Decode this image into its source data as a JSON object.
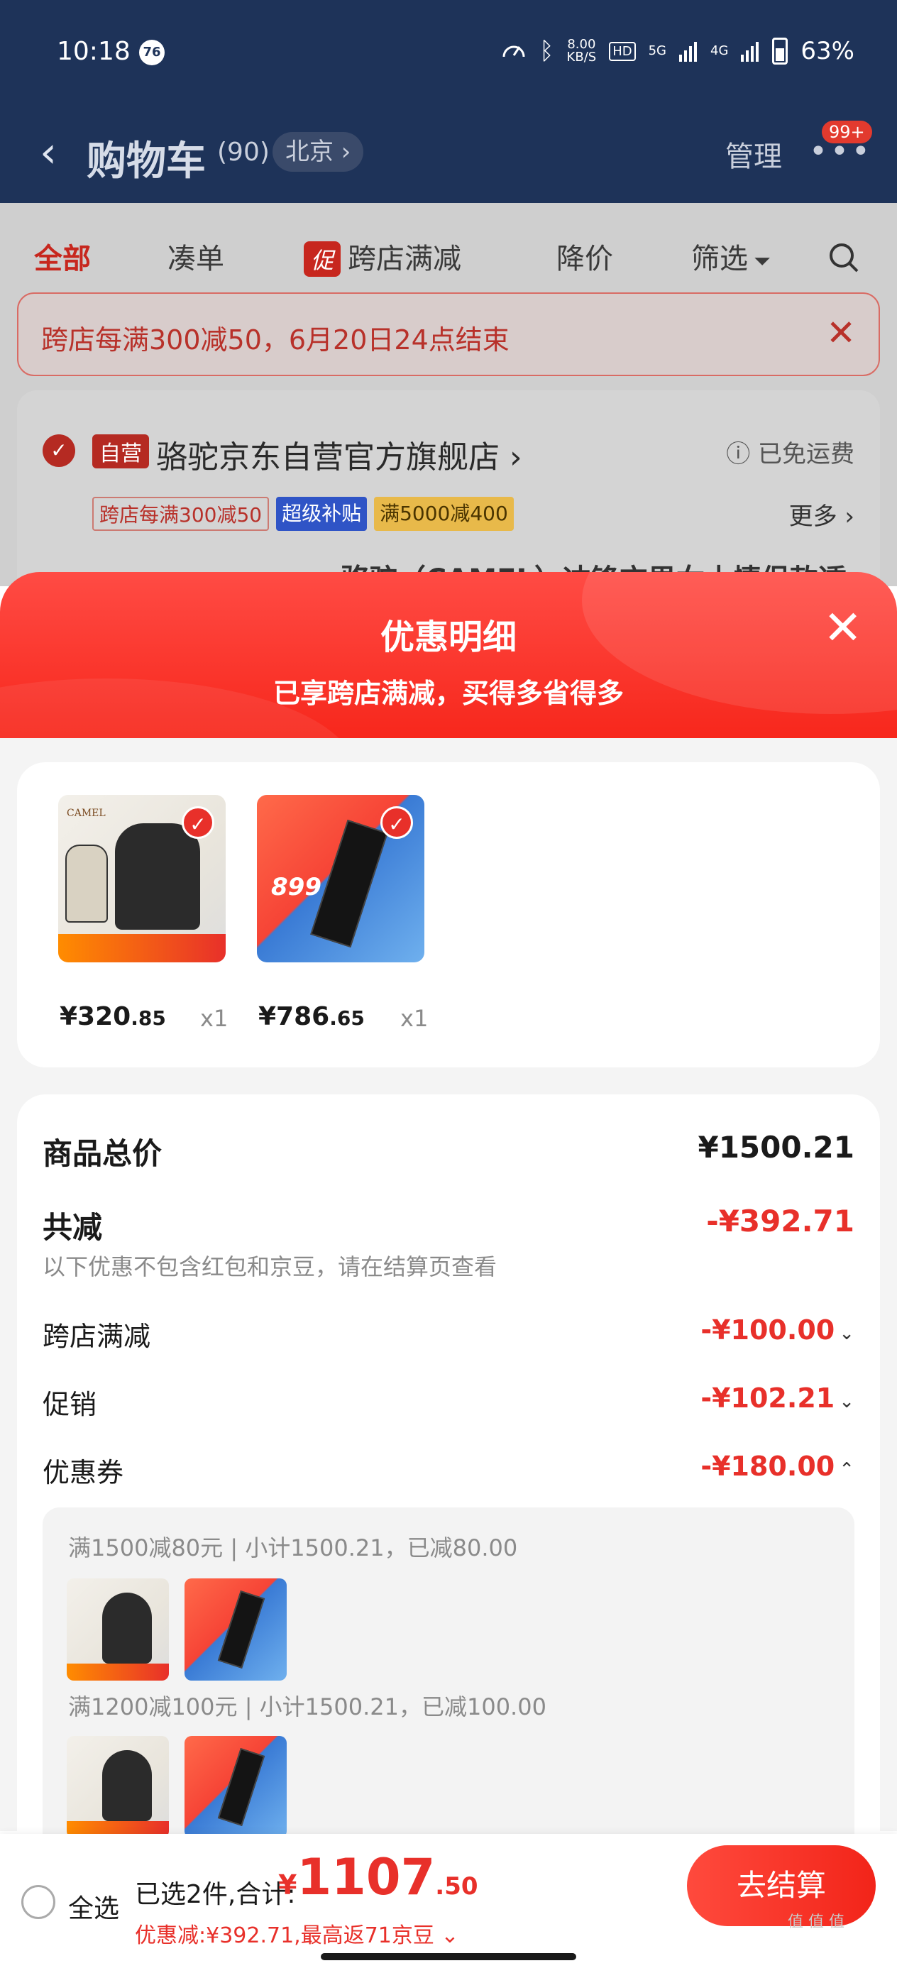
{
  "status_bar": {
    "time": "10:18",
    "notif_count": "76",
    "net_speed_top": "8.00",
    "net_speed_unit": "KB/S",
    "hd": "HD",
    "sig1": "5G",
    "sig2": "4G",
    "battery": "63%"
  },
  "nav": {
    "back": "‹",
    "title": "购物车",
    "count": "(90)",
    "city": "北京 ›",
    "manage": "管理",
    "more": "•••",
    "badge": "99+"
  },
  "tabs": [
    {
      "label": "全部"
    },
    {
      "label": "凑单"
    },
    {
      "icon_text": "促",
      "label": "跨店满减"
    },
    {
      "label": "降价"
    },
    {
      "label": "筛选"
    }
  ],
  "banner": {
    "text": "跨店每满300减50，6月20日24点结束",
    "close": "✕"
  },
  "store": {
    "badge": "自营",
    "name": "骆驼京东自营官方旗舰店 ›",
    "shipping": "ⓘ 已免运费",
    "tags": [
      "跨店每满300减50",
      "超级补贴",
      "满5000减400"
    ],
    "more": "更多 ›",
    "product_title_partial": "骆驼（CAMEL）冲锋衣男女士情侣款透"
  },
  "sheet": {
    "title": "优惠明细",
    "subtitle": "已享跨店满减，买得多省得多",
    "close": "✕"
  },
  "items": [
    {
      "price_int": "¥320",
      "price_dec": ".85",
      "qty": "x1",
      "thumb_brand": "CAMEL"
    },
    {
      "price_int": "¥786",
      "price_dec": ".65",
      "qty": "x1",
      "thumb_price": "899"
    }
  ],
  "summary": {
    "total_label": "商品总价",
    "total_value": "¥1500.21",
    "discount_label": "共减",
    "discount_value": "-¥392.71",
    "note": "以下优惠不包含红包和京豆，请在结算页查看",
    "rows": [
      {
        "label": "跨店满减",
        "value": "-¥100.00",
        "chev": "⌄"
      },
      {
        "label": "促销",
        "value": "-¥102.21",
        "chev": "⌄"
      },
      {
        "label": "优惠券",
        "value": "-¥180.00",
        "chev": "⌃"
      }
    ],
    "coupons": [
      {
        "text": "满1500减80元 | 小计1500.21，已减80.00"
      },
      {
        "text": "满1200减100元 | 小计1500.21，已减100.00"
      }
    ]
  },
  "checkout_bar": {
    "select_all": "全选",
    "selected": "已选2件,合计:",
    "currency": "¥",
    "total_int": "1107",
    "total_dec": ".50",
    "discount_line": "优惠减:¥392.71,最高返71京豆 ⌄",
    "button": "去结算"
  },
  "colors": {
    "header": "#1e3359",
    "accent_red": "#e8302a"
  }
}
